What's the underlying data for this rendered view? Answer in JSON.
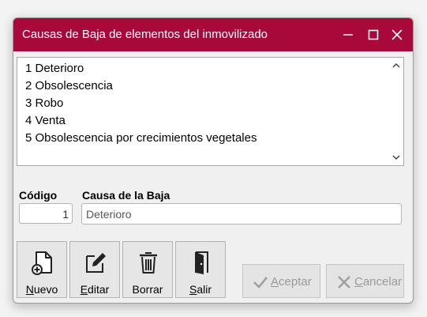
{
  "window": {
    "title": "Causas de Baja de elementos del inmovilizado",
    "accent_color": "#a8093a"
  },
  "list": {
    "items": [
      "1 Deterioro",
      "2 Obsolescencia",
      "3 Robo",
      "4 Venta",
      "5 Obsolescencia por crecimientos vegetales"
    ]
  },
  "form": {
    "code_label": "Código",
    "code_value": "1",
    "causa_label": "Causa de la Baja",
    "causa_value": "Deterioro"
  },
  "toolbar": {
    "nuevo": {
      "mnemonic": "N",
      "rest": "uevo",
      "icon": "new-document-icon"
    },
    "editar": {
      "mnemonic": "E",
      "rest": "ditar",
      "icon": "edit-pencil-icon"
    },
    "borrar": {
      "label": "Borrar",
      "icon": "trash-icon"
    },
    "salir": {
      "mnemonic": "S",
      "rest": "alir",
      "icon": "exit-door-icon"
    }
  },
  "dialog_buttons": {
    "aceptar": {
      "mnemonic": "A",
      "rest": "ceptar",
      "icon": "checkmark-icon"
    },
    "cancelar": {
      "mnemonic": "C",
      "rest": "ancelar",
      "icon": "cross-icon"
    }
  }
}
